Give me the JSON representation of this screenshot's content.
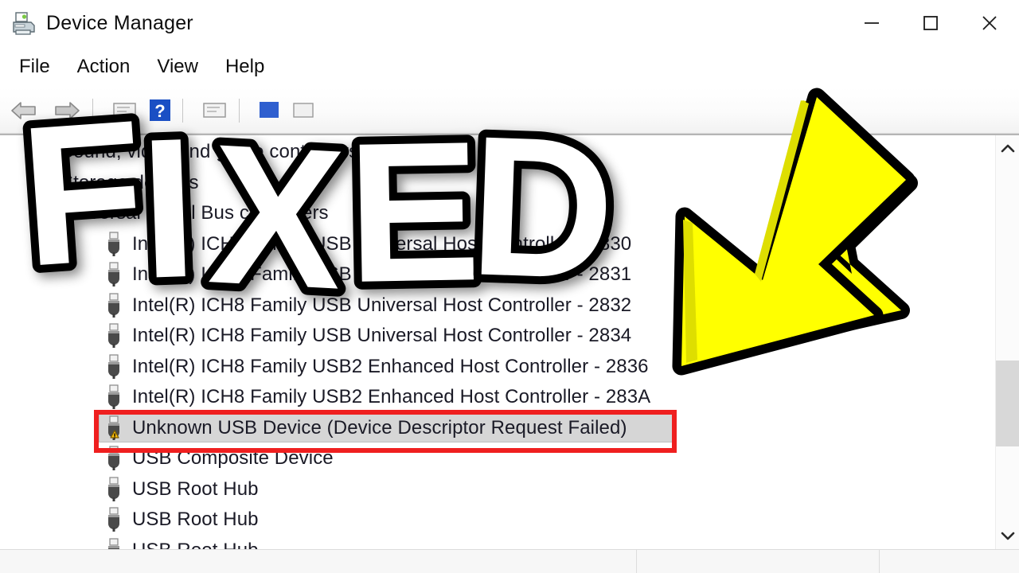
{
  "window": {
    "title": "Device Manager",
    "icon": "device-manager-icon",
    "controls": {
      "minimize": "minimize-icon",
      "maximize": "maximize-icon",
      "close": "close-icon"
    }
  },
  "menubar": {
    "items": [
      {
        "label": "File"
      },
      {
        "label": "Action"
      },
      {
        "label": "View"
      },
      {
        "label": "Help"
      }
    ]
  },
  "toolbar": {
    "items": [
      {
        "name": "back-arrow-icon"
      },
      {
        "name": "forward-arrow-icon"
      },
      {
        "name": "separator"
      },
      {
        "name": "properties-icon"
      },
      {
        "name": "help-icon"
      },
      {
        "name": "separator"
      },
      {
        "name": "scan-hardware-icon"
      },
      {
        "name": "separator"
      },
      {
        "name": "update-driver-icon"
      },
      {
        "name": "uninstall-device-icon"
      }
    ]
  },
  "tree": {
    "rows": [
      {
        "label": "Sound, video and game controllers",
        "icon": "category-icon",
        "indent": 40,
        "state": "expandable",
        "obscured": true
      },
      {
        "label": "Storage devices",
        "icon": "category-icon",
        "indent": 40,
        "state": "expandable",
        "obscured": true
      },
      {
        "label": "Universal Serial Bus controllers",
        "icon": "category-icon",
        "indent": 40,
        "state": "expanded",
        "obscured": true
      },
      {
        "label": "Intel(R) ICH8 Family USB Universal Host Controller - 2830",
        "icon": "usb-icon",
        "indent": 130
      },
      {
        "label": "Intel(R) ICH8 Family USB Universal Host Controller - 2831",
        "icon": "usb-icon",
        "indent": 130
      },
      {
        "label": "Intel(R) ICH8 Family USB Universal Host Controller - 2832",
        "icon": "usb-icon",
        "indent": 130
      },
      {
        "label": "Intel(R) ICH8 Family USB Universal Host Controller - 2834",
        "icon": "usb-icon",
        "indent": 130
      },
      {
        "label": "Intel(R) ICH8 Family USB2 Enhanced Host Controller - 2836",
        "icon": "usb-icon",
        "indent": 130
      },
      {
        "label": "Intel(R) ICH8 Family USB2 Enhanced Host Controller - 283A",
        "icon": "usb-icon",
        "indent": 130
      },
      {
        "label": "Unknown USB Device (Device Descriptor Request Failed)",
        "icon": "usb-warning-icon",
        "indent": 130,
        "selected": true,
        "highlighted": true
      },
      {
        "label": "USB Composite Device",
        "icon": "usb-icon",
        "indent": 130
      },
      {
        "label": "USB Root Hub",
        "icon": "usb-icon",
        "indent": 130
      },
      {
        "label": "USB Root Hub",
        "icon": "usb-icon",
        "indent": 130
      },
      {
        "label": "USB Root Hub",
        "icon": "usb-icon",
        "indent": 130,
        "clipped": true
      }
    ]
  },
  "scrollbar": {
    "up": "chevron-up-icon",
    "down": "chevron-down-icon",
    "thumb_top_pct": 55,
    "thumb_height_pct": 24
  },
  "statusbar": {
    "panes": [
      "",
      "",
      ""
    ]
  },
  "overlays": {
    "fixed_text": "FIXED",
    "fixed_text_color": "#ffffff",
    "fixed_outline_color": "#000000",
    "arrow": {
      "name": "down-left-arrow",
      "fill": "#ffff00",
      "stroke": "#000000"
    }
  },
  "colors": {
    "highlight_box": "#ef1f1f",
    "selection_bg": "#d6d6d6",
    "text": "#1a1a26",
    "warning_yellow": "#ffc20e",
    "help_blue": "#1a4fc4"
  }
}
